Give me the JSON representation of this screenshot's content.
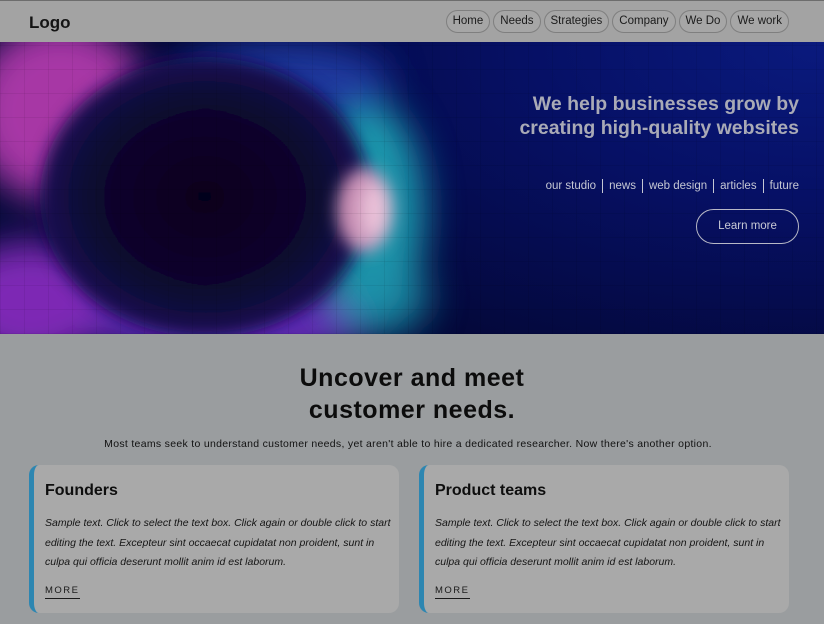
{
  "header": {
    "logo": "Logo",
    "nav": [
      "Home",
      "Needs",
      "Strategies",
      "Company",
      "We Do",
      "We work"
    ]
  },
  "hero": {
    "title": "We help businesses grow by creating high-quality websites",
    "links": [
      "our studio",
      "news",
      "web design",
      "articles",
      "future"
    ],
    "cta": "Learn more"
  },
  "section": {
    "title_line1": "Uncover and meet",
    "title_line2": "customer needs.",
    "description": "Most teams seek to understand customer needs, yet aren't able to hire a dedicated researcher. Now there's another option."
  },
  "cards": [
    {
      "title": "Founders",
      "text": "Sample text. Click to select the text box. Click again or double click to start editing the text. Excepteur sint occaecat cupidatat non proident, sunt in culpa qui officia deserunt mollit anim id est laborum.",
      "more": "MORE"
    },
    {
      "title": "Product teams",
      "text": "Sample text. Click to select the text box. Click again or double click to start editing the text. Excepteur sint occaecat cupidatat non proident, sunt in culpa qui officia deserunt mollit anim id est laborum.",
      "more": "MORE"
    }
  ],
  "colors": {
    "accent_bar": "#2d86b1",
    "hero_bg": "#061065"
  }
}
